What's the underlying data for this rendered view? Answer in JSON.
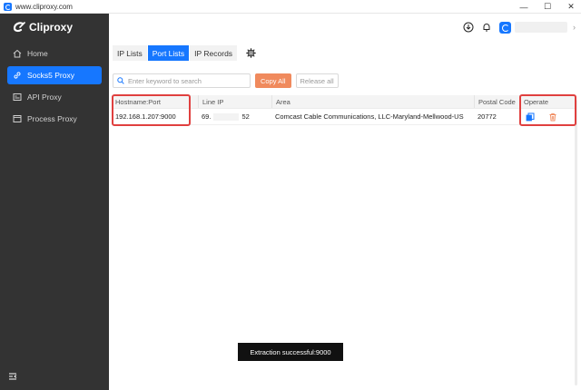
{
  "window": {
    "title": "www.cliproxy.com",
    "controls": {
      "minimize": "—",
      "maximize": "☐",
      "close": "✕"
    }
  },
  "brand": {
    "name": "Cliproxy",
    "color": "#1677ff"
  },
  "sidebar": {
    "items": [
      {
        "label": "Home",
        "icon": "home-icon",
        "active": false
      },
      {
        "label": "Socks5 Proxy",
        "icon": "link-icon",
        "active": true
      },
      {
        "label": "API Proxy",
        "icon": "api-icon",
        "active": false
      },
      {
        "label": "Process Proxy",
        "icon": "window-icon",
        "active": false
      }
    ],
    "bottom_icon": "menu-collapse-icon"
  },
  "header": {
    "icons": [
      "download-icon",
      "bell-icon",
      "avatar",
      "chevron-right-icon"
    ]
  },
  "tabs": [
    {
      "label": "IP Lists",
      "active": false
    },
    {
      "label": "Port Lists",
      "active": true
    },
    {
      "label": "IP Records",
      "active": false
    }
  ],
  "toolbar": {
    "search_placeholder": "Enter keyword to search",
    "copy_all_label": "Copy All",
    "release_all_label": "Release all"
  },
  "table": {
    "columns": [
      "Hostname:Port",
      "Line IP",
      "Area",
      "Postal Code",
      "Operate"
    ],
    "rows": [
      {
        "hostname_port": "192.168.1.207:9000",
        "line_ip_prefix": "69.",
        "line_ip_suffix": "52",
        "area": "Comcast Cable Communications, LLC-Maryland-Mellwood-US",
        "postal_code": "20772"
      }
    ]
  },
  "toast": {
    "message": "Extraction successful:9000"
  },
  "colors": {
    "accent": "#1677ff",
    "sidebar_bg": "#333333",
    "copy_button": "#f08a5d",
    "highlight": "#e0403f",
    "delete_icon": "#f08a5d"
  }
}
